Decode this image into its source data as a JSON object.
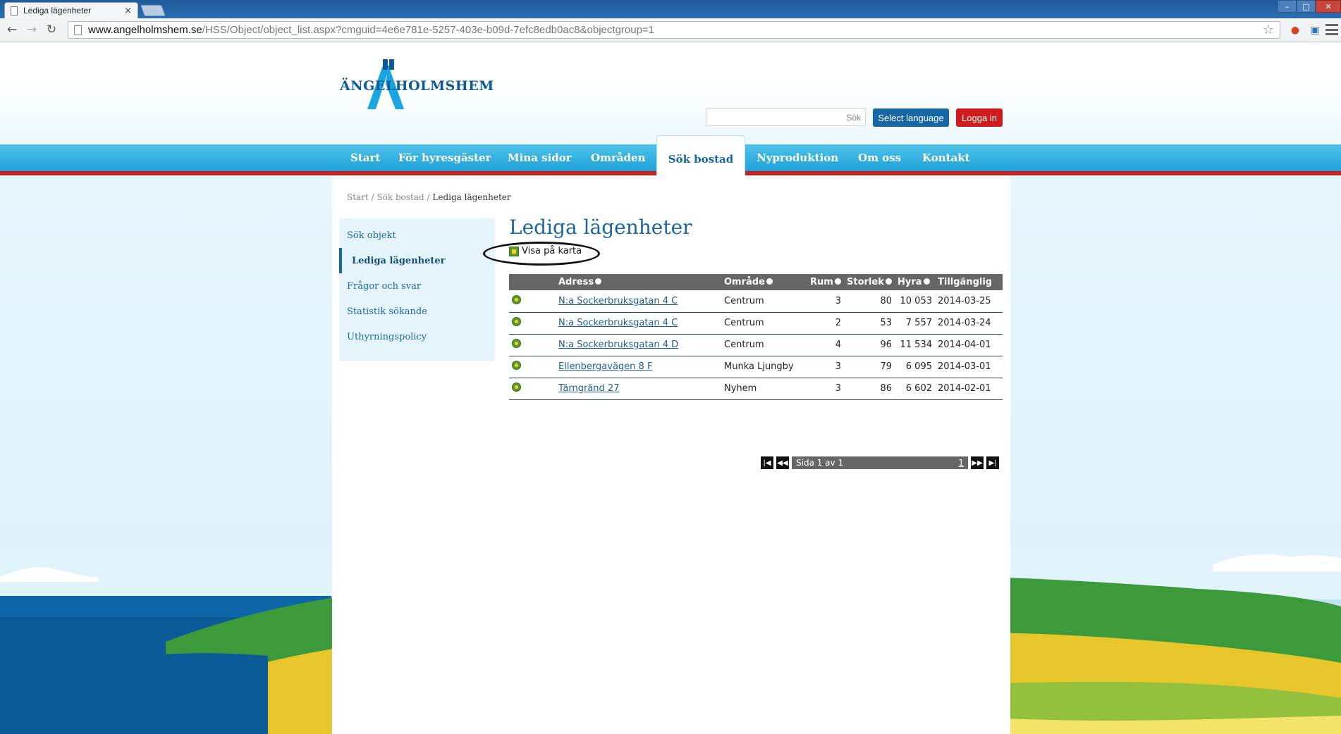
{
  "browser": {
    "tab_title": "Lediga lägenheter",
    "tab_close": "×",
    "url_host": "www.angelholmshem.se",
    "url_path": "/HSS/Object/object_list.aspx?cmguid=4e6e781e-5257-403e-b09d-7efc8edb0ac8&objectgroup=1",
    "back": "←",
    "forward": "→",
    "reload": "↻",
    "star": "☆",
    "min": "–",
    "max": "□",
    "close": "✕"
  },
  "header": {
    "logo_text": "ÄNGELHOLMSHEM",
    "search_label": "Sök",
    "select_language": "Select language",
    "login": "Logga in"
  },
  "nav": {
    "items": [
      "Start",
      "För hyresgäster",
      "Mina sidor",
      "Områden",
      "Sök bostad",
      "Nyproduktion",
      "Om oss",
      "Kontakt"
    ],
    "active": "Sök bostad"
  },
  "breadcrumb": {
    "items": [
      "Start",
      "Sök bostad",
      "Lediga lägenheter"
    ],
    "separator": " / "
  },
  "sidebar": {
    "items": [
      "Sök objekt",
      "Lediga lägenheter",
      "Frågor och svar",
      "Statistik sökande",
      "Uthyrningspolicy"
    ],
    "active_index": 1
  },
  "main": {
    "title": "Lediga lägenheter",
    "map_link": "Visa på karta"
  },
  "table": {
    "headers": [
      "Adress",
      "Område",
      "Rum",
      "Storlek",
      "Hyra",
      "Tillgänglig"
    ],
    "rows": [
      {
        "address": "N:a Sockerbruksgatan 4 C",
        "area": "Centrum",
        "rooms": "3",
        "size": "80",
        "rent": "10 053",
        "available": "2014-03-25"
      },
      {
        "address": "N:a Sockerbruksgatan 4 C",
        "area": "Centrum",
        "rooms": "2",
        "size": "53",
        "rent": "7 557",
        "available": "2014-03-24"
      },
      {
        "address": "N:a Sockerbruksgatan 4 D",
        "area": "Centrum",
        "rooms": "4",
        "size": "96",
        "rent": "11 534",
        "available": "2014-04-01"
      },
      {
        "address": "Ellenbergavägen 8 F",
        "area": "Munka Ljungby",
        "rooms": "3",
        "size": "79",
        "rent": "6 095",
        "available": "2014-03-01"
      },
      {
        "address": "Tärngränd 27",
        "area": "Nyhem",
        "rooms": "3",
        "size": "86",
        "rent": "6 602",
        "available": "2014-02-01"
      }
    ]
  },
  "pager": {
    "info": "Sida 1 av 1",
    "current": "1",
    "first": "|◀",
    "prev": "◀◀",
    "next": "▶▶",
    "last": "▶|"
  },
  "colors": {
    "brand_blue": "#1767a6",
    "nav_cyan": "#1ea2d9",
    "red": "#c9201e"
  }
}
